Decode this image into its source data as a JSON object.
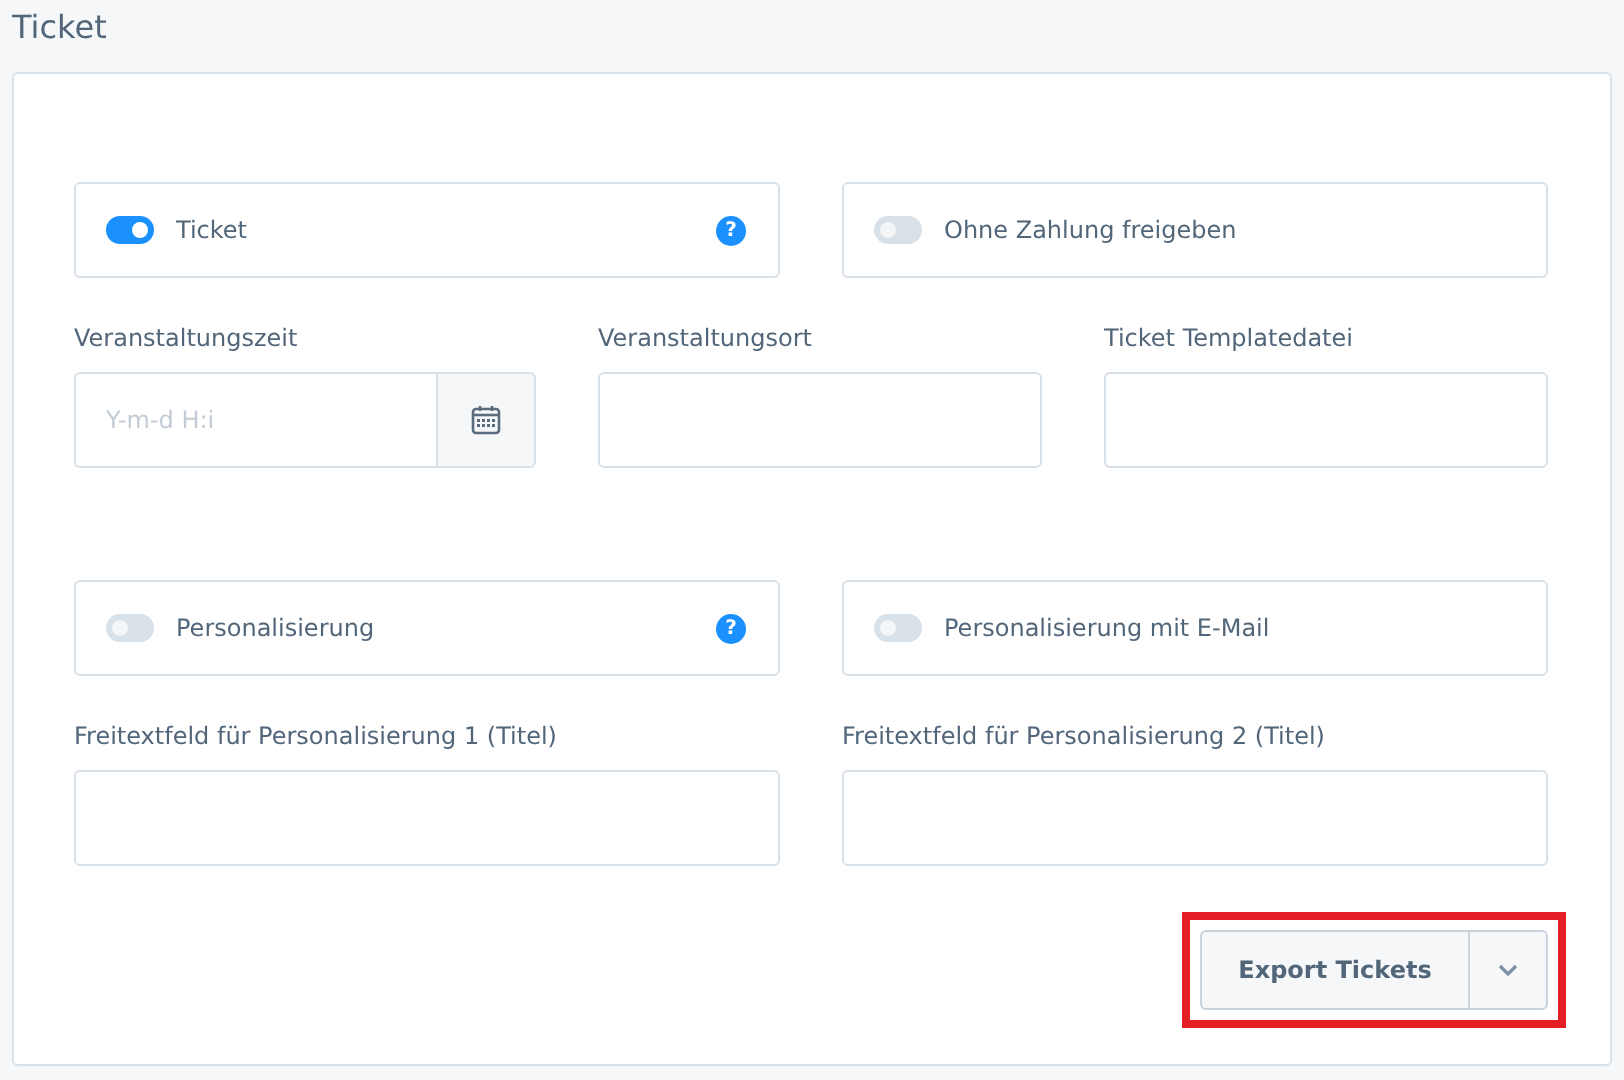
{
  "title": "Ticket",
  "sections": [
    {
      "toggles": [
        {
          "label": "Ticket",
          "on": true,
          "help": "?"
        },
        {
          "label": "Ohne Zahlung freigeben",
          "on": false
        }
      ],
      "fields": [
        {
          "kind": "date",
          "label": "Veranstaltungszeit",
          "placeholder": "Y-m-d H:i"
        },
        {
          "kind": "text",
          "label": "Veranstaltungsort"
        },
        {
          "kind": "text",
          "label": "Ticket Templatedatei"
        }
      ]
    },
    {
      "toggles": [
        {
          "label": "Personalisierung",
          "on": false,
          "help": "?"
        },
        {
          "label": "Personalisierung mit E-Mail",
          "on": false
        }
      ],
      "fields": [
        {
          "kind": "text",
          "label": "Freitextfeld für Personalisierung 1 (Titel)"
        },
        {
          "kind": "text",
          "label": "Freitextfeld für Personalisierung 2 (Titel)"
        }
      ]
    }
  ],
  "export_button": {
    "label": "Export Tickets",
    "highlighted": true
  }
}
